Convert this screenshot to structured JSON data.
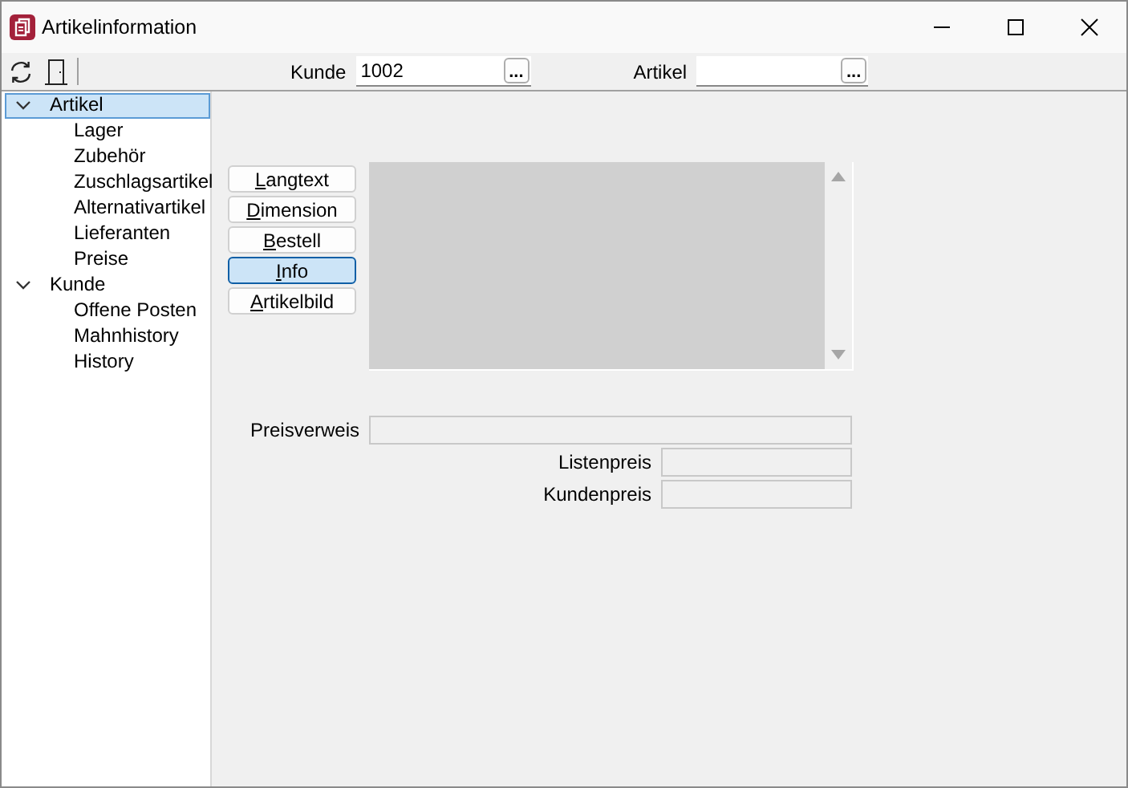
{
  "window": {
    "title": "Artikelinformation"
  },
  "toolbar": {
    "fields": [
      {
        "label": "Kunde",
        "value": "1002",
        "browse": "..."
      },
      {
        "label": "Artikel",
        "browse": "..."
      }
    ]
  },
  "tree": [
    {
      "label": "Artikel",
      "expanded": true,
      "selected": true,
      "children": [
        {
          "label": "Lager",
          "selected": false
        },
        {
          "label": "Zubehör",
          "selected": false
        },
        {
          "label": "Zuschlagsartikel",
          "selected": false
        },
        {
          "label": "Alternativartikel",
          "selected": false
        },
        {
          "label": "Lieferanten",
          "selected": false
        },
        {
          "label": "Preise",
          "selected": false
        }
      ]
    },
    {
      "label": "Kunde",
      "expanded": true,
      "selected": false,
      "children": [
        {
          "label": "Offene Posten",
          "selected": false
        },
        {
          "label": "Mahnhistory",
          "selected": false
        },
        {
          "label": "History",
          "selected": false
        }
      ]
    }
  ],
  "buttons": [
    {
      "label": "Langtext",
      "selected": false
    },
    {
      "label": "Dimension",
      "selected": false
    },
    {
      "label": "Bestell",
      "selected": false
    },
    {
      "label": "Info",
      "selected": true
    },
    {
      "label": "Artikelbild",
      "selected": false
    }
  ],
  "fields": [
    {
      "label": "Preisverweis",
      "kind": "wide"
    },
    {
      "label": "Listenpreis",
      "kind": "short"
    },
    {
      "label": "Kundenpreis",
      "kind": "short"
    }
  ]
}
